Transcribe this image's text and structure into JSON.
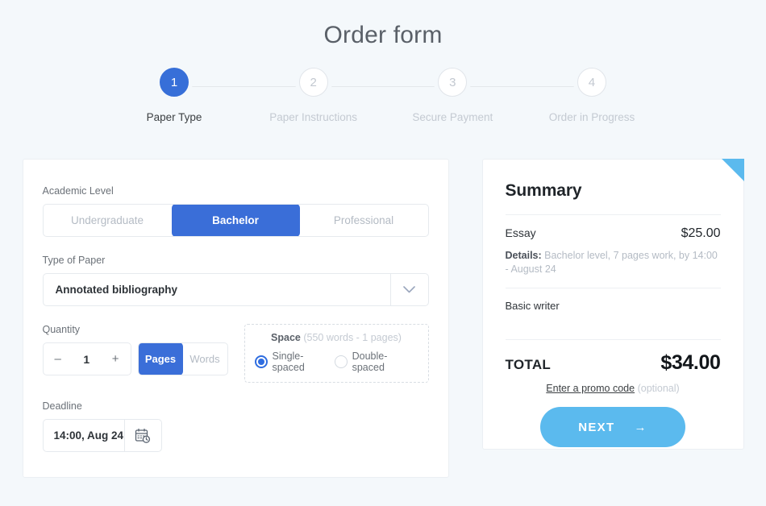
{
  "page": {
    "title": "Order form",
    "background": "#f4f8fb",
    "accent_blue": "#3a6ed8",
    "accent_sky": "#5bbaee"
  },
  "stepper": {
    "steps": [
      {
        "number": "1",
        "label": "Paper Type",
        "active": true
      },
      {
        "number": "2",
        "label": "Paper Instructions",
        "active": false
      },
      {
        "number": "3",
        "label": "Secure Payment",
        "active": false
      },
      {
        "number": "4",
        "label": "Order in Progress",
        "active": false
      }
    ]
  },
  "form": {
    "academic_level": {
      "label": "Academic Level",
      "options": [
        "Undergraduate",
        "Bachelor",
        "Professional"
      ],
      "selected": "Bachelor"
    },
    "type_of_paper": {
      "label": "Type of Paper",
      "value": "Annotated bibliography",
      "chevron": "chevron-down-icon"
    },
    "quantity": {
      "label": "Quantity",
      "value": "1",
      "decrement": "–",
      "increment": "+",
      "units": [
        "Pages",
        "Words"
      ],
      "selected_unit": "Pages"
    },
    "space": {
      "title": "Space",
      "hint": "(550 words - 1 pages)",
      "options": [
        "Single-spaced",
        "Double-spaced"
      ],
      "selected": "Single-spaced"
    },
    "deadline": {
      "label": "Deadline",
      "value": "14:00, Aug 24",
      "icon": "calendar-clock-icon"
    }
  },
  "summary": {
    "title": "Summary",
    "item_name": "Essay",
    "item_price": "$25.00",
    "details_label": "Details:",
    "details_text": "Bachelor level, 7 pages work, by 14:00 - August 24",
    "writer": "Basic writer",
    "total_label": "TOTAL",
    "total_value": "$34.00",
    "promo_link": "Enter a promo code",
    "promo_optional": "(optional)",
    "next_label": "NEXT",
    "next_arrow": "→"
  }
}
